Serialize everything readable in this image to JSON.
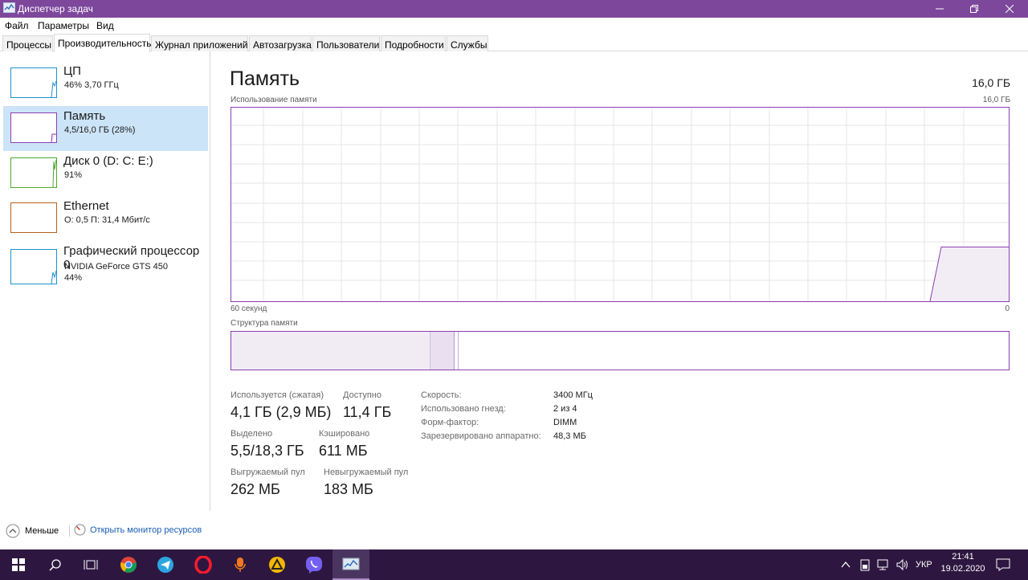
{
  "window": {
    "title": "Диспетчер задач"
  },
  "menu": [
    "Файл",
    "Параметры",
    "Вид"
  ],
  "tabs": [
    "Процессы",
    "Производительность",
    "Журнал приложений",
    "Автозагрузка",
    "Пользователи",
    "Подробности",
    "Службы"
  ],
  "active_tab": "Производительность",
  "sidebar": {
    "items": [
      {
        "name": "ЦП",
        "line1": "46% 3,70 ГГц",
        "line2": "",
        "color": "#1f8fce"
      },
      {
        "name": "Память",
        "line1": "4,5/16,0 ГБ (28%)",
        "line2": "",
        "color": "#8b3fb2"
      },
      {
        "name": "Диск 0 (D: C: E:)",
        "line1": "91%",
        "line2": "",
        "color": "#4ea72e"
      },
      {
        "name": "Ethernet",
        "line1": "О: 0,5 П: 31,4 Мбит/с",
        "line2": "",
        "color": "#b8611f"
      },
      {
        "name": "Графический процессор 0",
        "line1": "NVIDIA GeForce GTS 450",
        "line2": "44%",
        "color": "#1f8fce"
      }
    ]
  },
  "main": {
    "title": "Память",
    "total": "16,0 ГБ",
    "usage_label": "Использование памяти",
    "usage_max": "16,0 ГБ",
    "time_left": "60 секунд",
    "time_right": "0",
    "composition_label": "Структура памяти"
  },
  "stats": {
    "in_use_label": "Используется (сжатая)",
    "in_use_value": "4,1 ГБ (2,9 МБ)",
    "available_label": "Доступно",
    "available_value": "11,4 ГБ",
    "committed_label": "Выделено",
    "committed_value": "5,5/18,3 ГБ",
    "cached_label": "Кэшировано",
    "cached_value": "611 МБ",
    "paged_label": "Выгружаемый пул",
    "paged_value": "262 МБ",
    "nonpaged_label": "Невыгружаемый пул",
    "nonpaged_value": "183 МБ"
  },
  "props": [
    {
      "key": "Скорость:",
      "value": "3400 МГц"
    },
    {
      "key": "Использовано гнезд:",
      "value": "2 из 4"
    },
    {
      "key": "Форм-фактор:",
      "value": "DIMM"
    },
    {
      "key": "Зарезервировано аппаратно:",
      "value": "48,3 МБ"
    }
  ],
  "footer": {
    "less": "Меньше",
    "resmon": "Открыть монитор ресурсов"
  },
  "taskbar": {
    "lang": "УКР",
    "time": "21:41",
    "date": "19.02.2020"
  },
  "colors": {
    "accent": "#8b3fb2",
    "titlebar": "#7d479c",
    "taskbar": "#2d1740",
    "selection": "#cce4f7"
  },
  "graph": {
    "memory_usage_fraction": 0.28
  }
}
